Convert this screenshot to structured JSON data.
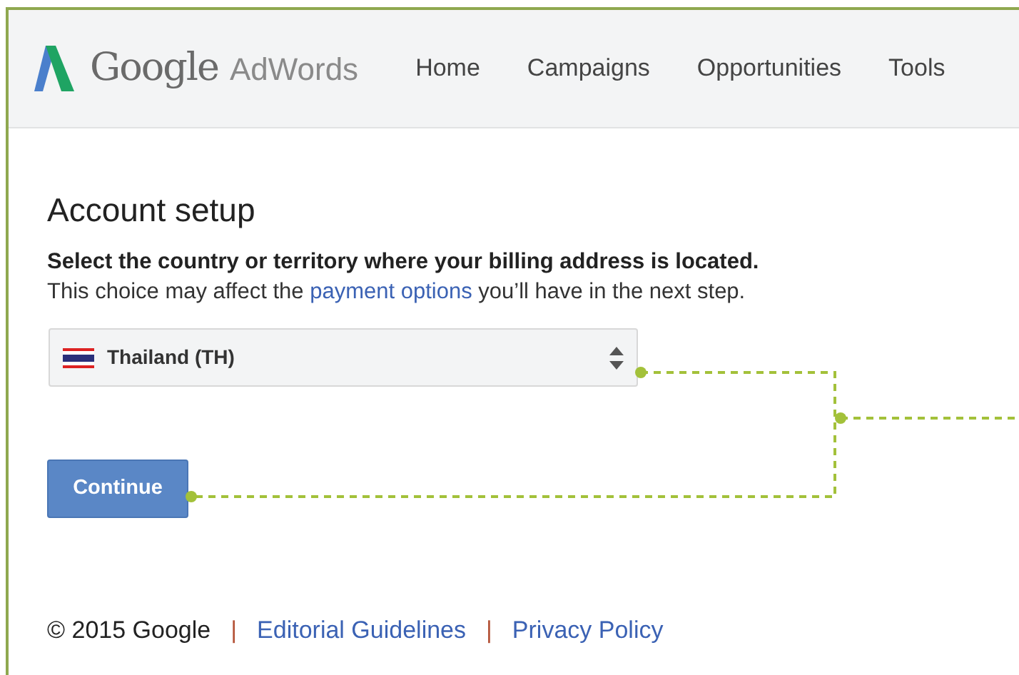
{
  "header": {
    "logo_google": "Google",
    "logo_product": "AdWords",
    "nav": [
      {
        "label": "Home"
      },
      {
        "label": "Campaigns"
      },
      {
        "label": "Opportunities"
      },
      {
        "label": "Tools"
      }
    ]
  },
  "page": {
    "title": "Account setup",
    "instruction": "Select the country or territory where your billing address is located.",
    "note": {
      "before": "This choice may affect the ",
      "link": "payment options",
      "after": " you’ll have in the next step."
    },
    "country_select": {
      "value": "Thailand (TH)"
    },
    "button": "Continue"
  },
  "footer": {
    "copyright": "© 2015 Google",
    "separator": "|",
    "links": [
      "Editorial Guidelines",
      "Privacy Policy"
    ]
  }
}
